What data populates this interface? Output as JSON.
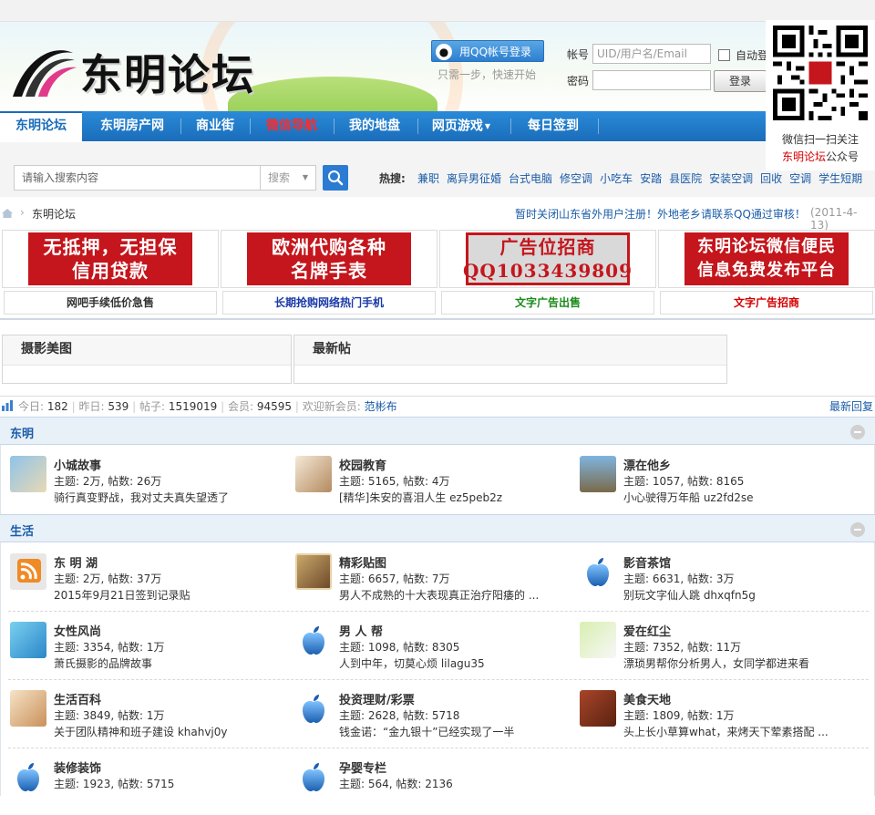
{
  "header": {
    "logo_text": "东明论坛",
    "qq_login": "用QQ帐号登录",
    "qq_sub": "只需一步，快速开始",
    "account_label": "帐号",
    "account_placeholder": "UID/用户名/Email",
    "password_label": "密码",
    "auto_login": "自动登录",
    "login_button": "登录"
  },
  "qr": {
    "caption_line1": "微信扫一扫关注",
    "caption_brand": "东明论坛",
    "caption_suffix": "公众号"
  },
  "nav": {
    "items": [
      "东明论坛",
      "东明房产网",
      "商业街",
      "微信导航",
      "我的地盘",
      "网页游戏",
      "每日签到"
    ]
  },
  "search": {
    "placeholder": "请输入搜索内容",
    "type": "搜索",
    "hot_label": "热搜:",
    "hot_terms": [
      "兼职",
      "离异男征婚",
      "台式电脑",
      "修空调",
      "小吃车",
      "安踏",
      "县医院",
      "安装空调",
      "回收",
      "空调",
      "学生短期"
    ]
  },
  "breadcrumb": {
    "current": "东明论坛",
    "notice": "暂时关闭山东省外用户注册！外地老乡请联系QQ通过审核！",
    "notice_date": "(2011-4-13)"
  },
  "ads": {
    "banners": [
      "无抵押，无担保\n信用贷款",
      "欧洲代购各种\n名牌手表",
      "广告位招商\nQQ1033439809",
      "东明论坛微信便民\n信息免费发布平台"
    ],
    "texts": [
      "网吧手续低价急售",
      "长期抢购网络热门手机",
      "文字广告出售",
      "文字广告招商"
    ],
    "text_colors": [
      "#333333",
      "#1a3aa8",
      "#1a8a1a",
      "#d40000"
    ]
  },
  "panels": {
    "left": "摄影美图",
    "right": "最新帖"
  },
  "stats": {
    "today_label": "今日:",
    "today": "182",
    "yesterday_label": "昨日:",
    "yesterday": "539",
    "posts_label": "帖子:",
    "posts": "1519019",
    "members_label": "会员:",
    "members": "94595",
    "welcome": "欢迎新会员:",
    "new_member": "范彬布",
    "latest_reply": "最新回复"
  },
  "categories": [
    {
      "title": "东明",
      "forums": [
        {
          "name": "小城故事",
          "stats": "主题: 2万, 帖数: 26万",
          "last": "骑行真变野战，我对丈夫真失望透了",
          "icon": "photo-icon"
        },
        {
          "name": "校园教育",
          "stats": "主题: 5165, 帖数: 4万",
          "last": "[精华]朱安的喜泪人生  ez5peb2z",
          "icon": "writing-icon"
        },
        {
          "name": "漂在他乡",
          "stats": "主题: 1057, 帖数: 8165",
          "last": "小心驶得万年船  uz2fd2se",
          "icon": "traveler-icon"
        }
      ]
    },
    {
      "title": "生活",
      "forums": [
        {
          "name": "东 明 湖",
          "stats": "主题: 2万, 帖数: 37万",
          "last": "2015年9月21日签到记录贴",
          "icon": "rss-icon"
        },
        {
          "name": "精彩贴图",
          "stats": "主题: 6657, 帖数: 7万",
          "last": "男人不成熟的十大表现真正治疗阳痿的 ...",
          "icon": "couple-photo-icon"
        },
        {
          "name": "影音茶馆",
          "stats": "主题: 6631, 帖数: 3万",
          "last": "别玩文字仙人跳  dhxqfn5g",
          "icon": "apple-icon"
        },
        {
          "name": "女性风尚",
          "stats": "主题: 3354, 帖数: 1万",
          "last": "萧氏摄影的品牌故事",
          "icon": "woman-icon"
        },
        {
          "name": "男 人 帮",
          "stats": "主题: 1098, 帖数: 8305",
          "last": "人到中年，切莫心烦  lilagu35",
          "icon": "apple-icon"
        },
        {
          "name": "爱在红尘",
          "stats": "主题: 7352, 帖数: 11万",
          "last": "漂琐男帮你分析男人，女同学都进来看",
          "icon": "flower-icon"
        },
        {
          "name": "生活百科",
          "stats": "主题: 3849, 帖数: 1万",
          "last": "关于团队精神和班子建设  khahvj0y",
          "icon": "girl-icon"
        },
        {
          "name": "投资理财/彩票",
          "stats": "主题: 2628, 帖数: 5718",
          "last": "钱金诺：“金九银十”已经实现了一半",
          "icon": "apple-icon"
        },
        {
          "name": "美食天地",
          "stats": "主题: 1809, 帖数: 1万",
          "last": "头上长小草算what，来烤天下荤素搭配 ...",
          "icon": "food-icon"
        },
        {
          "name": "装修装饰",
          "stats": "主题: 1923, 帖数: 5715",
          "last": "",
          "icon": "apple-icon"
        },
        {
          "name": "孕婴专栏",
          "stats": "主题: 564, 帖数: 2136",
          "last": "",
          "icon": "apple-icon"
        }
      ]
    }
  ]
}
